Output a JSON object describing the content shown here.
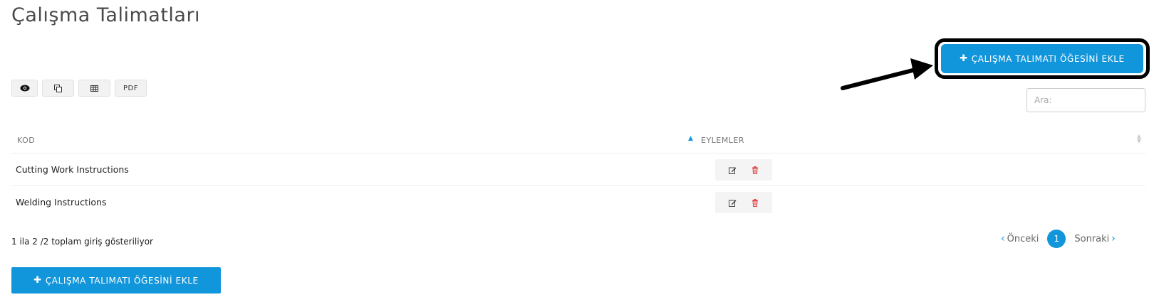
{
  "page": {
    "title": "Çalışma Talimatları"
  },
  "actions": {
    "add_button_label": "ÇALIŞMA TALIMATI ÖĞESİNİ EKLE",
    "add_button_icon": "plus-icon",
    "accent_color": "#1296db"
  },
  "toolbar": {
    "buttons": [
      {
        "icon": "eye-icon"
      },
      {
        "icon": "copy-icon"
      },
      {
        "icon": "table-csv-icon"
      },
      {
        "label": "PDF"
      }
    ]
  },
  "search": {
    "placeholder": "Ara:"
  },
  "table": {
    "columns": [
      "KOD",
      "EYLEMLER"
    ],
    "rows": [
      {
        "kod": "Cutting Work Instructions"
      },
      {
        "kod": "Welding Instructions"
      }
    ],
    "row_actions": [
      "edit-icon",
      "trash-icon"
    ]
  },
  "footer": {
    "info": "1 ila 2 /2 toplam giriş gösteriliyor",
    "pagination": {
      "prev": "Önceki",
      "current": "1",
      "next": "Sonraki"
    }
  }
}
